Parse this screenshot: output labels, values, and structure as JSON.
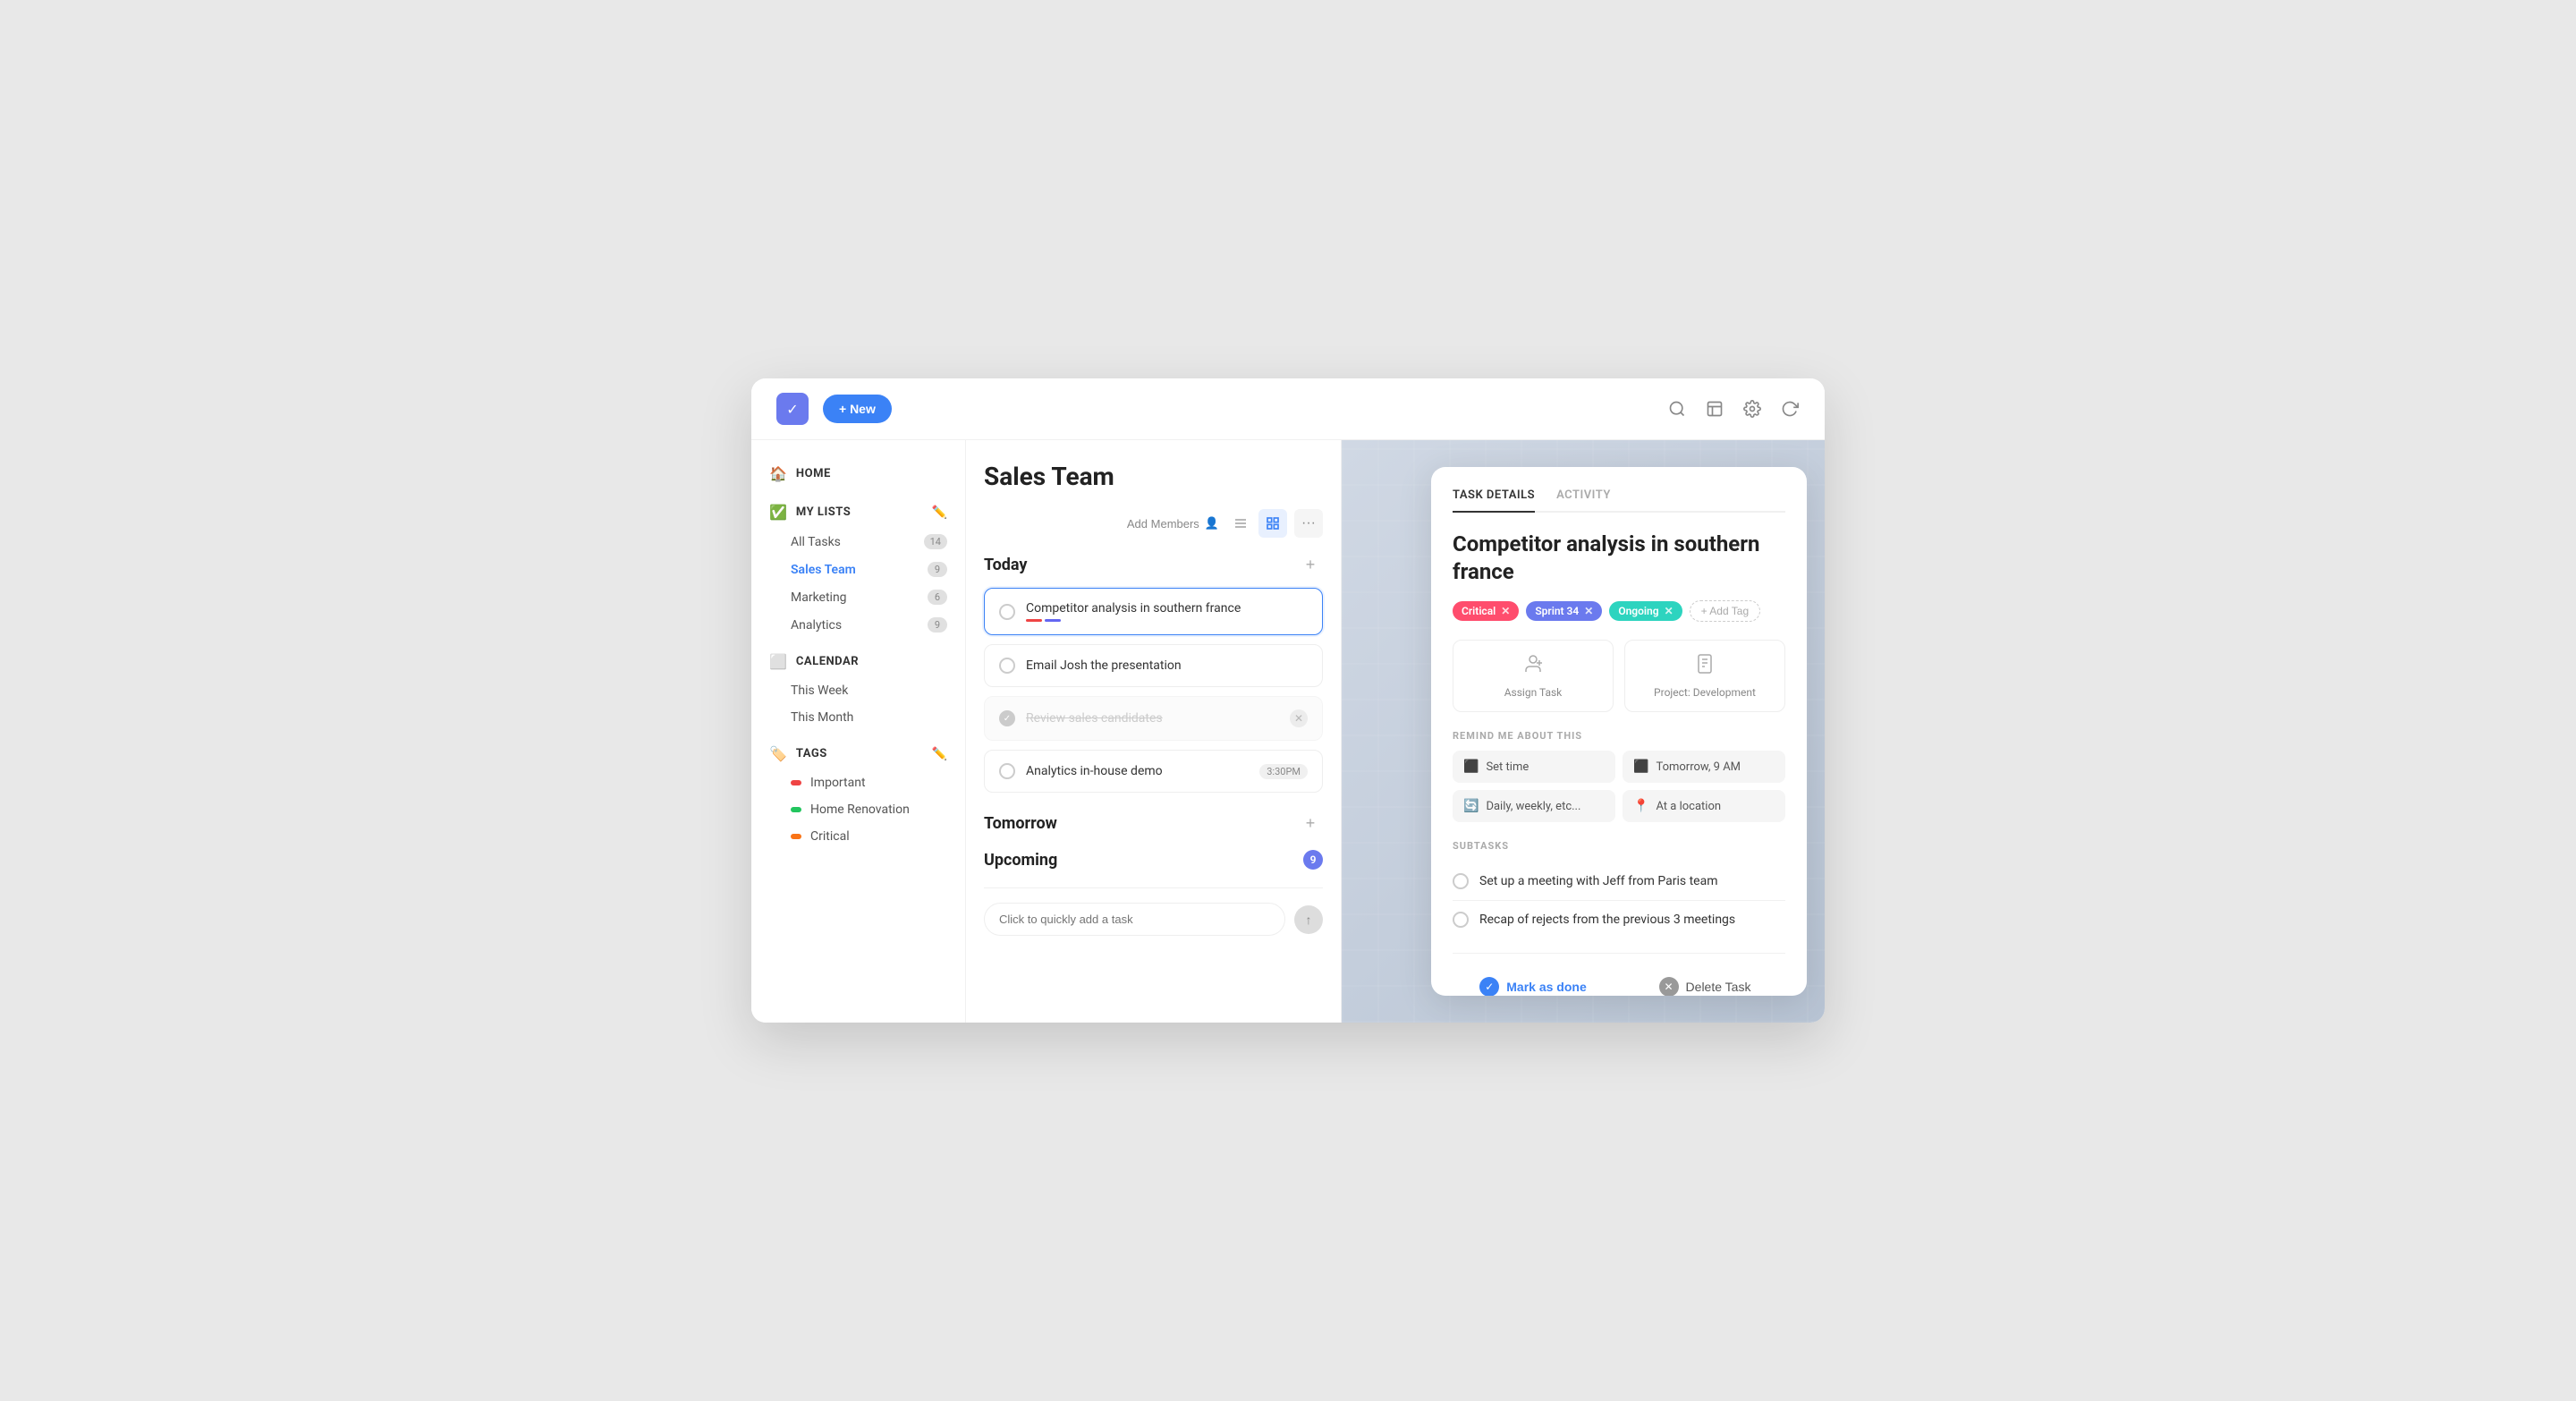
{
  "topbar": {
    "new_label": "+ New",
    "logo_icon": "✓"
  },
  "sidebar": {
    "home_label": "HOME",
    "my_lists_label": "MY LISTS",
    "calendar_label": "CALENDAR",
    "tags_label": "TAGS",
    "lists": [
      {
        "label": "All Tasks",
        "badge": "14",
        "active": false
      },
      {
        "label": "Sales Team",
        "badge": "9",
        "active": true
      },
      {
        "label": "Marketing",
        "badge": "6",
        "active": false
      },
      {
        "label": "Analytics",
        "badge": "9",
        "active": false
      }
    ],
    "calendar_items": [
      {
        "label": "This Week"
      },
      {
        "label": "This Month"
      }
    ],
    "tags": [
      {
        "label": "Important",
        "color": "#ef4444"
      },
      {
        "label": "Home Renovation",
        "color": "#22c55e"
      },
      {
        "label": "Critical",
        "color": "#f97316"
      }
    ]
  },
  "panel": {
    "title": "Sales Team",
    "add_members_label": "Add Members",
    "sections": {
      "today": "Today",
      "tomorrow": "Tomorrow",
      "upcoming": "Upcoming",
      "upcoming_badge": "9"
    },
    "tasks_today": [
      {
        "id": "task1",
        "text": "Competitor analysis in southern france",
        "completed": false,
        "selected": true,
        "indicators": [
          "#ef4444",
          "#6366f1"
        ]
      },
      {
        "id": "task2",
        "text": "Email Josh the presentation",
        "completed": false,
        "selected": false,
        "indicators": []
      },
      {
        "id": "task3",
        "text": "Review sales candidates",
        "completed": true,
        "selected": false,
        "indicators": []
      },
      {
        "id": "task4",
        "text": "Analytics in-house demo",
        "completed": false,
        "selected": false,
        "tag": "3:30PM",
        "indicators": []
      }
    ],
    "quick_add_placeholder": "Click to quickly add a task"
  },
  "details": {
    "tabs": [
      {
        "label": "TASK DETAILS",
        "active": true
      },
      {
        "label": "ACTIVITY",
        "active": false
      }
    ],
    "title": "Competitor analysis in southern france",
    "tags": [
      {
        "label": "Critical",
        "type": "critical"
      },
      {
        "label": "Sprint 34",
        "type": "sprint"
      },
      {
        "label": "Ongoing",
        "type": "ongoing"
      }
    ],
    "add_tag_label": "+ Add Tag",
    "actions": [
      {
        "icon": "👥",
        "label": "Assign Task"
      },
      {
        "icon": "📋",
        "label": "Project: Development"
      }
    ],
    "remind_label": "REMIND ME ABOUT THIS",
    "remind_items": [
      {
        "icon": "⏰",
        "label": "Set time"
      },
      {
        "icon": "📅",
        "label": "Tomorrow, 9 AM"
      },
      {
        "icon": "🔄",
        "label": "Daily, weekly, etc..."
      },
      {
        "icon": "📍",
        "label": "At a location"
      }
    ],
    "subtasks_label": "SUBTASKS",
    "subtasks": [
      {
        "text": "Set up a meeting with Jeff from Paris team",
        "done": false
      },
      {
        "text": "Recap of rejects from the previous 3 meetings",
        "done": false
      }
    ],
    "mark_done_label": "Mark as done",
    "delete_label": "Delete Task"
  }
}
